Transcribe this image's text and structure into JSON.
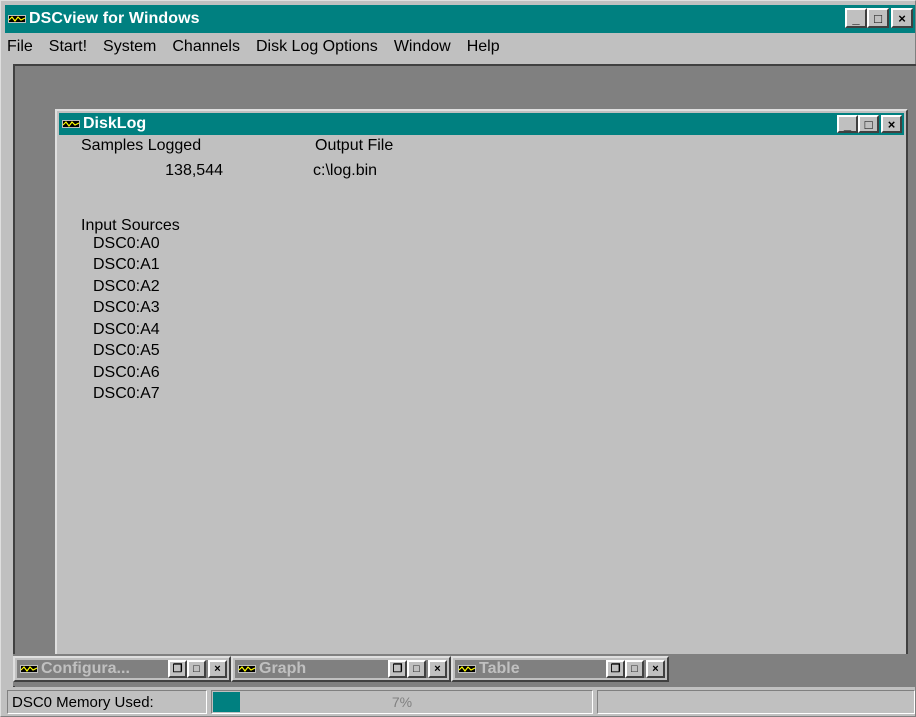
{
  "app": {
    "title": "DSCview for Windows",
    "icon": "dscview-app-icon",
    "controls": [
      "_",
      "□",
      "×"
    ]
  },
  "menubar": [
    {
      "label": "File"
    },
    {
      "label": "Start!"
    },
    {
      "label": "System"
    },
    {
      "label": "Channels"
    },
    {
      "label": "Disk Log Options"
    },
    {
      "label": "Window"
    },
    {
      "label": "Help"
    }
  ],
  "disklog": {
    "title": "DiskLog",
    "samples_label": "Samples Logged",
    "samples_value": "138,544",
    "output_label": "Output File",
    "output_value": "c:\\log.bin",
    "inputs_label": "Input Sources",
    "inputs": [
      "DSC0:A0",
      "DSC0:A1",
      "DSC0:A2",
      "DSC0:A3",
      "DSC0:A4",
      "DSC0:A5",
      "DSC0:A6",
      "DSC0:A7"
    ]
  },
  "minimized_windows": [
    {
      "title": "Configura..."
    },
    {
      "title": "Graph"
    },
    {
      "title": "Table"
    }
  ],
  "statusbar": {
    "memory_label": "DSC0 Memory Used:",
    "memory_percent_text": "7%",
    "memory_fraction": 0.07
  },
  "colors": {
    "titlebar_active": "#008080",
    "face": "#c0c0c0",
    "workspace": "#808080"
  }
}
